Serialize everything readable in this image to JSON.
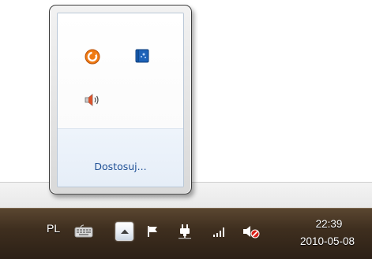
{
  "overflow_popup": {
    "icons": [
      {
        "name": "orange-app-icon",
        "color": "#f07a12"
      },
      {
        "name": "blue-app-icon",
        "color": "#1d62b8"
      },
      {
        "name": "volume-icon",
        "color": "#8a8a8a"
      }
    ],
    "customize_label": "Dostosuj..."
  },
  "taskbar": {
    "language": "PL",
    "tray_icons": [
      "keyboard-icon",
      "show-hidden-icons-button",
      "flag-icon",
      "power-plug-icon",
      "network-signal-icon",
      "volume-muted-icon"
    ],
    "clock": {
      "time": "22:39",
      "date": "2010-05-08"
    }
  },
  "colors": {
    "taskbar_top": "#5a4630",
    "taskbar_bottom": "#2c2016",
    "link": "#1e4f95",
    "popup_bottom": "#e6eef8",
    "mute_red": "#d8221a"
  }
}
